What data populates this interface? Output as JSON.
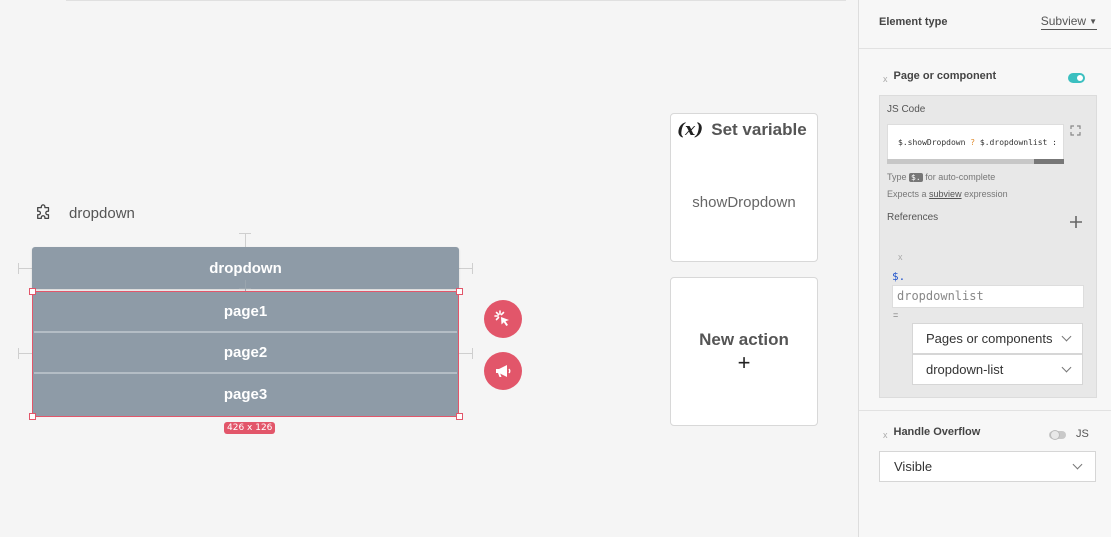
{
  "canvas": {
    "component_name": "dropdown",
    "dropdown": {
      "header_label": "dropdown",
      "items": [
        {
          "label": "page1"
        },
        {
          "label": "page2"
        },
        {
          "label": "page3"
        }
      ],
      "size_badge": "426 x 126"
    },
    "fab_icons": [
      "tap-icon",
      "megaphone-icon"
    ],
    "actions": {
      "set_variable": {
        "icon_label": "(x)",
        "title": "Set variable",
        "value": "showDropdown"
      },
      "new_action": {
        "title": "New action",
        "plus": "+"
      }
    },
    "accent_color": "#e2566a"
  },
  "panel": {
    "element_type_label": "Element type",
    "element_type_value": "Subview",
    "page_or_component": {
      "x": "x",
      "title": "Page or component",
      "toggle_on": true,
      "js_code_label": "JS Code",
      "code_part1": "$.showDropdown",
      "code_op": "?",
      "code_part2": "$.dropdownlist :",
      "hint_prefix": "Type",
      "hint_kbd": "$.",
      "hint_suffix": "for auto-complete",
      "expects_prefix": "Expects a",
      "expects_link": "subview",
      "expects_suffix": "expression",
      "references_label": "References",
      "ref_x": "x",
      "ref_dollar": "$.",
      "ref_value": "dropdownlist",
      "ref_eq": "=",
      "ref_type_select": "Pages or components",
      "ref_target_select": "dropdown-list"
    },
    "handle_overflow": {
      "x": "x",
      "title": "Handle Overflow",
      "js_label": "JS",
      "value": "Visible"
    },
    "toggle_color": "#3bbfc0"
  }
}
